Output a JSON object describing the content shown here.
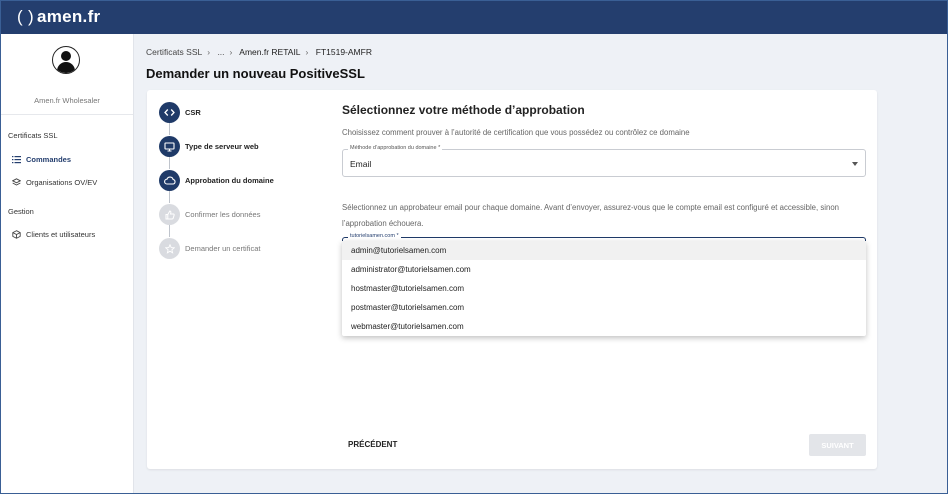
{
  "brand": {
    "logo_bracket": "( )",
    "logo_text": "amen.fr"
  },
  "sidebar": {
    "org_name": "Amen.fr Wholesaler",
    "sections": [
      {
        "title": "Certificats SSL",
        "items": [
          {
            "label": "Commandes",
            "icon": "list-icon",
            "active": true
          },
          {
            "label": "Organisations OV/EV",
            "icon": "layers-icon",
            "active": false
          }
        ]
      },
      {
        "title": "Gestion",
        "items": [
          {
            "label": "Clients et utilisateurs",
            "icon": "cube-icon",
            "active": false
          }
        ]
      }
    ]
  },
  "breadcrumb": [
    "Certificats SSL",
    "...",
    "Amen.fr RETAIL",
    "FT1519-AMFR"
  ],
  "page_title": "Demander un nouveau PositiveSSL",
  "stepper": [
    {
      "label": "CSR",
      "icon": "code-icon",
      "state": "done"
    },
    {
      "label": "Type de serveur web",
      "icon": "monitor-icon",
      "state": "done"
    },
    {
      "label": "Approbation du domaine",
      "icon": "cloud-icon",
      "state": "active"
    },
    {
      "label": "Confirmer les données",
      "icon": "thumb-up-icon",
      "state": "todo"
    },
    {
      "label": "Demander un certificat",
      "icon": "star-icon",
      "state": "todo"
    }
  ],
  "approval": {
    "heading": "Sélectionnez votre méthode d’approbation",
    "intro": "Choisissez comment prouver à l’autorité de certification que vous possédez ou contrôlez ce domaine",
    "method_label": "Méthode d’approbation du domaine *",
    "method_value": "Email",
    "hint": "Sélectionnez un approbateur email pour chaque domaine. Avant d’envoyer, assurez-vous que le compte email est configuré et accessible, sinon l’approbation échouera.",
    "domain_label": "tutorielsamen.com *",
    "options": [
      "admin@tutorielsamen.com",
      "administrator@tutorielsamen.com",
      "hostmaster@tutorielsamen.com",
      "postmaster@tutorielsamen.com",
      "webmaster@tutorielsamen.com"
    ]
  },
  "actions": {
    "prev": "PRÉCÉDENT",
    "next": "SUIVANT"
  },
  "colors": {
    "navy": "#243e6e",
    "step_done": "#1f3a68",
    "step_todo": "#d9dbe0"
  }
}
